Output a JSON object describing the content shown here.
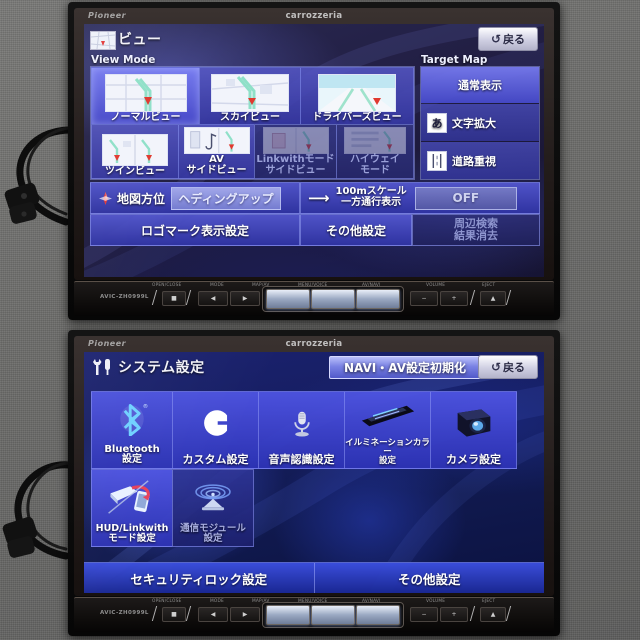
{
  "device": {
    "brand_left": "Pioneer",
    "brand_center": "carrozzeria",
    "model_label": "AVIC-ZH0999L"
  },
  "hardware_buttons": {
    "labels_top": [
      "OPEN/CLOSE",
      "MODE",
      "MAP/AV",
      "MENU/VOICE",
      "AV/NAVI",
      "VOLUME",
      "EJECT"
    ],
    "left": [
      "■",
      "◀",
      "▶"
    ],
    "right": [
      "−",
      "+",
      "▲"
    ]
  },
  "top_screen": {
    "header": {
      "icon": "map-view-icon",
      "title": "ビュー",
      "back_label": "戻る",
      "back_icon": "back-arrow-icon"
    },
    "view_mode": {
      "panel_label": "View Mode",
      "tiles": [
        {
          "label": "ノーマルビュー",
          "state": "selected",
          "thumb": "normal-view-thumb"
        },
        {
          "label": "スカイビュー",
          "state": "normal",
          "thumb": "sky-view-thumb"
        },
        {
          "label": "ドライバーズビュー",
          "state": "normal",
          "thumb": "drivers-view-thumb"
        },
        {
          "label": "ツインビュー",
          "state": "normal",
          "thumb": "twin-view-thumb"
        },
        {
          "label": "AV\nサイドビュー",
          "state": "normal",
          "thumb": "av-side-view-thumb"
        },
        {
          "label": "Linkwithモード\nサイドビュー",
          "state": "disabled",
          "thumb": "linkwith-side-view-thumb"
        },
        {
          "label": "ハイウェイ\nモード",
          "state": "disabled",
          "thumb": "highway-mode-thumb"
        }
      ]
    },
    "target_map": {
      "panel_label": "Target Map",
      "rows": [
        {
          "label": "通常表示",
          "state": "selected",
          "icon": ""
        },
        {
          "label": "文字拡大",
          "state": "normal",
          "icon": "あ"
        },
        {
          "label": "道路重視",
          "state": "normal",
          "icon": "road-icon"
        }
      ]
    },
    "controls": {
      "map_orientation": {
        "icon": "compass-icon",
        "label": "地図方位",
        "value": "ヘディングアップ"
      },
      "oneway": {
        "icon": "arrow-right-icon",
        "label_line1": "100mスケール",
        "label_line2": "一方通行表示",
        "value": "OFF"
      },
      "logo_button": "ロゴマーク表示設定",
      "other_button": "その他設定",
      "clear_button_line1": "周辺検索",
      "clear_button_line2": "結果消去"
    }
  },
  "bottom_screen": {
    "header": {
      "icon": "tools-icon",
      "title": "システム設定",
      "reset_button": "NAVI・AV設定初期化",
      "back_label": "戻る",
      "back_icon": "back-arrow-icon"
    },
    "tiles_row1": [
      {
        "label": "Bluetooth\n設定",
        "icon": "bluetooth-icon",
        "state": "normal"
      },
      {
        "label": "カスタム設定",
        "icon": "custom-c-icon",
        "state": "normal"
      },
      {
        "label": "音声認識設定",
        "icon": "microphone-icon",
        "state": "normal"
      },
      {
        "label": "イルミネーションカラー\n設定",
        "icon": "illumination-color-icon",
        "state": "normal"
      },
      {
        "label": "カメラ設定",
        "icon": "camera-icon",
        "state": "normal"
      }
    ],
    "tiles_row2": [
      {
        "label": "HUD/Linkwith\nモード設定",
        "icon": "hud-linkwith-icon",
        "state": "normal"
      },
      {
        "label": "通信モジュール\n設定",
        "icon": "comm-module-icon",
        "state": "disabled"
      }
    ],
    "bottom_bar": [
      "セキュリティロック設定",
      "その他設定"
    ]
  },
  "colors": {
    "screen_blue": "#2a2a52",
    "system_blue": "#1b2270",
    "tile_selected": "#787df5",
    "tile_normal": "#4e54e2",
    "accent_white": "#ffffff"
  }
}
